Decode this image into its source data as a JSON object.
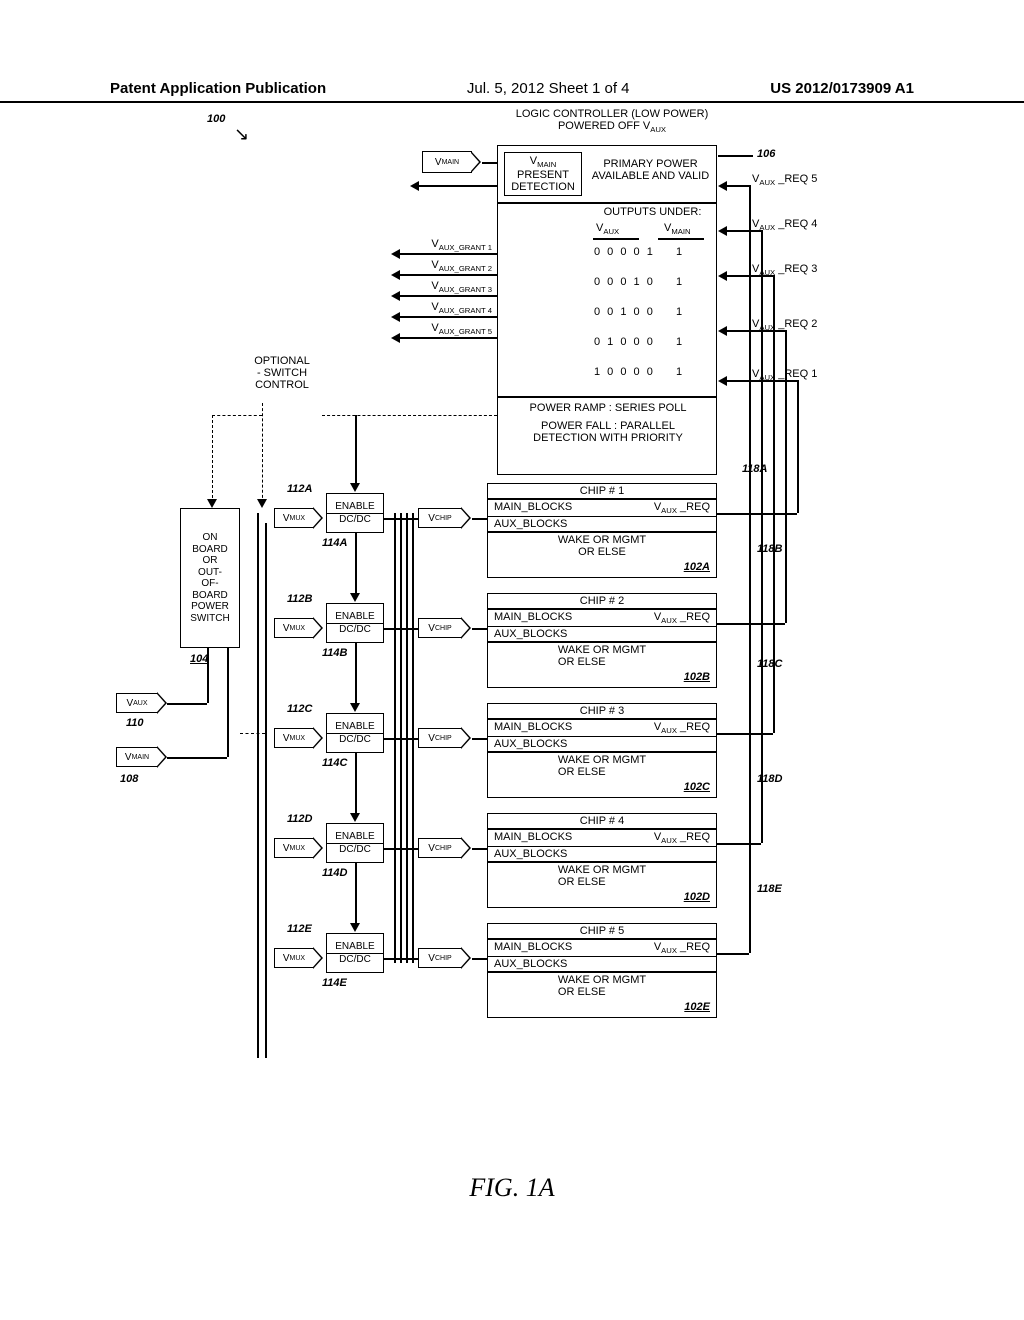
{
  "header": {
    "left": "Patent Application Publication",
    "center": "Jul. 5, 2012   Sheet 1 of 4",
    "right": "US 2012/0173909 A1"
  },
  "figure_label": "FIG. 1A",
  "ref_100": "100",
  "ref_106": "106",
  "ref_104": "104",
  "ref_108": "108",
  "ref_110": "110",
  "optional_text": "OPTIONAL\n- SWITCH\nCONTROL",
  "switch_text": "ON\nBOARD\nOR\nOUT-\nOF-\nBOARD\nPOWER\nSWITCH",
  "vaux": "VAUX",
  "vmain": "VMAIN",
  "vmux": "VMUX",
  "vchip": "VCHIP",
  "enable": "ENABLE",
  "dcdc": "DC/DC",
  "controller": {
    "title": "LOGIC CONTROLLER (LOW POWER)\nPOWERED OFF VAUX",
    "detect": "VMAIN\nPRESENT\nDETECTION",
    "primary": "PRIMARY POWER\nAVAILABLE AND VALID",
    "outputs_under": "OUTPUTS UNDER:",
    "cols": [
      "VAUX",
      "VMAIN"
    ],
    "grants": [
      "VAUX_GRANT 1",
      "VAUX_GRANT 2",
      "VAUX_GRANT 3",
      "VAUX_GRANT 4",
      "VAUX_GRANT 5"
    ],
    "rows": [
      [
        "0 0 0 0 1",
        "1"
      ],
      [
        "0 0 0 1 0",
        "1"
      ],
      [
        "0 0 1 0 0",
        "1"
      ],
      [
        "0 1 0 0 0",
        "1"
      ],
      [
        "1 0 0 0 0",
        "1"
      ]
    ],
    "ramp": "POWER RAMP : SERIES POLL",
    "fall": "POWER FALL : PARALLEL\nDETECTION WITH PRIORITY"
  },
  "reqs": [
    "VAUX _REQ 5",
    "VAUX _REQ 4",
    "VAUX _REQ 3",
    "VAUX _REQ 2",
    "VAUX _REQ 1"
  ],
  "chip_req_label": "VAUX _REQ",
  "chips": [
    {
      "title": "CHIP # 1",
      "ref": "102A",
      "r": "118A",
      "mux": "112A",
      "dc": "114A"
    },
    {
      "title": "CHIP # 2",
      "ref": "102B",
      "r": "118B",
      "mux": "112B",
      "dc": "114B"
    },
    {
      "title": "CHIP # 3",
      "ref": "102C",
      "r": "118C",
      "mux": "112C",
      "dc": "114C"
    },
    {
      "title": "CHIP # 4",
      "ref": "102D",
      "r": "118D",
      "mux": "112D",
      "dc": "114D"
    },
    {
      "title": "CHIP # 5",
      "ref": "102E",
      "r": "118E",
      "mux": "112E",
      "dc": "114E"
    }
  ],
  "chip_lines": {
    "main": "MAIN_BLOCKS",
    "aux": "AUX_BLOCKS",
    "wake": "WAKE OR MGMT\nOR ELSE"
  }
}
